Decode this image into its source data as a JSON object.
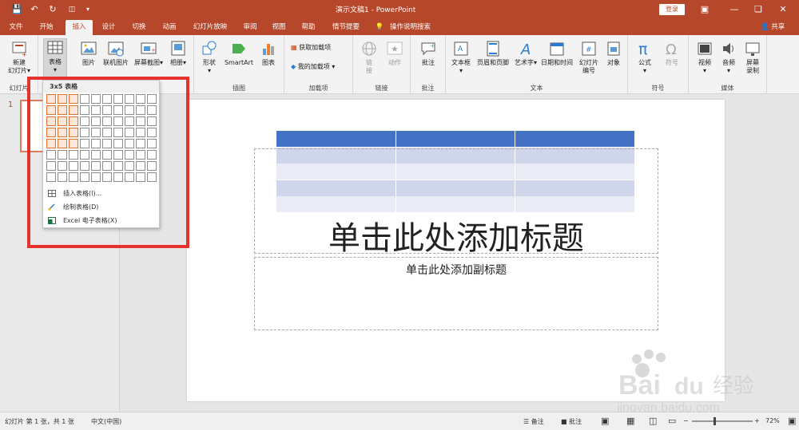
{
  "titlebar": {
    "title": "演示文稿1  -  PowerPoint",
    "login_label": "登录"
  },
  "tabs": [
    "文件",
    "开始",
    "插入",
    "设计",
    "切换",
    "动画",
    "幻灯片放映",
    "审阅",
    "视图",
    "帮助",
    "情节提要"
  ],
  "active_tab": "插入",
  "tell_me": "操作说明搜索",
  "share_label": "共享",
  "ribbon": {
    "new_slide": [
      "新建",
      "幻灯片"
    ],
    "table": "表格",
    "picture": "图片",
    "online_picture": "联机图片",
    "screenshot": "屏幕截图",
    "album": "相册",
    "shapes": "形状",
    "smartart": "SmartArt",
    "chart": "图表",
    "get_addins": "获取加载项",
    "my_addins": "我的加载项",
    "link": [
      "链",
      "接"
    ],
    "action": "动作",
    "comment": "批注",
    "textbox": "文本框",
    "header_footer": "页眉和页脚",
    "wordart": "艺术字",
    "datetime": "日期和时间",
    "slide_number": [
      "幻灯片",
      "编号"
    ],
    "object": "对象",
    "equation": "公式",
    "symbol": "符号",
    "video": "视频",
    "audio": "音频",
    "screen_recording": [
      "屏幕",
      "录制"
    ],
    "groups": {
      "slides": "幻灯片",
      "illustrations": "插图",
      "addins": "加载项",
      "links": "链接",
      "comments": "批注",
      "text": "文本",
      "symbols": "符号",
      "media": "媒体"
    }
  },
  "table_dropdown": {
    "header": "3x5 表格",
    "grid_cols": 10,
    "grid_rows": 8,
    "selected_cols": 3,
    "selected_rows": 5,
    "items": [
      {
        "label": "插入表格(I)...",
        "icon": "insert-table-icon"
      },
      {
        "label": "绘制表格(D)",
        "icon": "draw-table-icon"
      },
      {
        "label": "Excel 电子表格(X)",
        "icon": "excel-icon"
      }
    ]
  },
  "slide_pane": {
    "slide_number": "1"
  },
  "slide": {
    "title_placeholder": "单击此处添加标题",
    "subtitle_placeholder": "单击此处添加副标题",
    "preview_table": {
      "cols": 3,
      "rows": 5
    }
  },
  "status": {
    "slide_info": "幻灯片 第 1 张，共 1 张",
    "language": "中文(中国)",
    "notes": "备注",
    "comments": "批注",
    "zoom": "72%"
  },
  "watermark": {
    "brand": "Bai du 经验",
    "url": "jingyan.baidu.com"
  },
  "colors": {
    "accent": "#b7472a",
    "table_header": "#4472c4",
    "table_band_dark": "#cfd5ea",
    "table_band_light": "#e9ebf5",
    "highlight_box": "#e5322d"
  }
}
